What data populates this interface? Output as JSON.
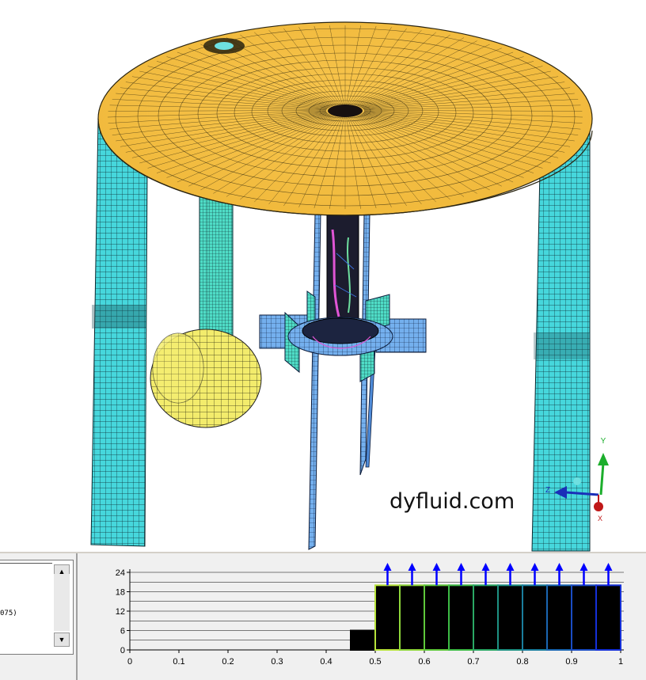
{
  "viewport": {
    "watermark": "dyfluid.com",
    "axes_triad": {
      "y_label": "Y",
      "z_label": "Z",
      "x_label": "X"
    }
  },
  "text_pane": {
    "visible_text": "075)"
  },
  "scrollbar": {
    "up_icon": "▲",
    "down_icon": "▼"
  },
  "colors": {
    "lid": "#f6c24a",
    "legs": "#44d6da",
    "shaft_dark": "#222244",
    "impeller": "#6fa8e8",
    "bin_fill": "#000000",
    "arrow": "#0000ff"
  },
  "chart_data": {
    "type": "bar",
    "xlim": [
      0,
      1
    ],
    "ylim": [
      0,
      24
    ],
    "x_ticks": [
      "0",
      "0.1",
      "0.2",
      "0.3",
      "0.4",
      "0.5",
      "0.6",
      "0.7",
      "0.8",
      "0.9",
      "1"
    ],
    "y_ticks": [
      "0",
      "6",
      "12",
      "18",
      "24"
    ],
    "grid": "horizontal",
    "bins": [
      {
        "x0": 0.45,
        "x1": 0.5,
        "value": 6,
        "edge": "#000000",
        "overflow": false
      },
      {
        "x0": 0.5,
        "x1": 0.55,
        "value": 20,
        "edge": "#b7e23a",
        "overflow": true
      },
      {
        "x0": 0.55,
        "x1": 0.6,
        "value": 20,
        "edge": "#8fd63a",
        "overflow": true
      },
      {
        "x0": 0.6,
        "x1": 0.65,
        "value": 20,
        "edge": "#5fc83a",
        "overflow": true
      },
      {
        "x0": 0.65,
        "x1": 0.7,
        "value": 20,
        "edge": "#3dbb45",
        "overflow": true
      },
      {
        "x0": 0.7,
        "x1": 0.75,
        "value": 20,
        "edge": "#2aa864",
        "overflow": true
      },
      {
        "x0": 0.75,
        "x1": 0.8,
        "value": 20,
        "edge": "#1e9283",
        "overflow": true
      },
      {
        "x0": 0.8,
        "x1": 0.85,
        "value": 20,
        "edge": "#1a7e9e",
        "overflow": true
      },
      {
        "x0": 0.85,
        "x1": 0.9,
        "value": 20,
        "edge": "#1a66b2",
        "overflow": true
      },
      {
        "x0": 0.9,
        "x1": 0.95,
        "value": 20,
        "edge": "#1a4cc4",
        "overflow": true
      },
      {
        "x0": 0.95,
        "x1": 1.0,
        "value": 20,
        "edge": "#1530d8",
        "overflow": true
      }
    ]
  }
}
